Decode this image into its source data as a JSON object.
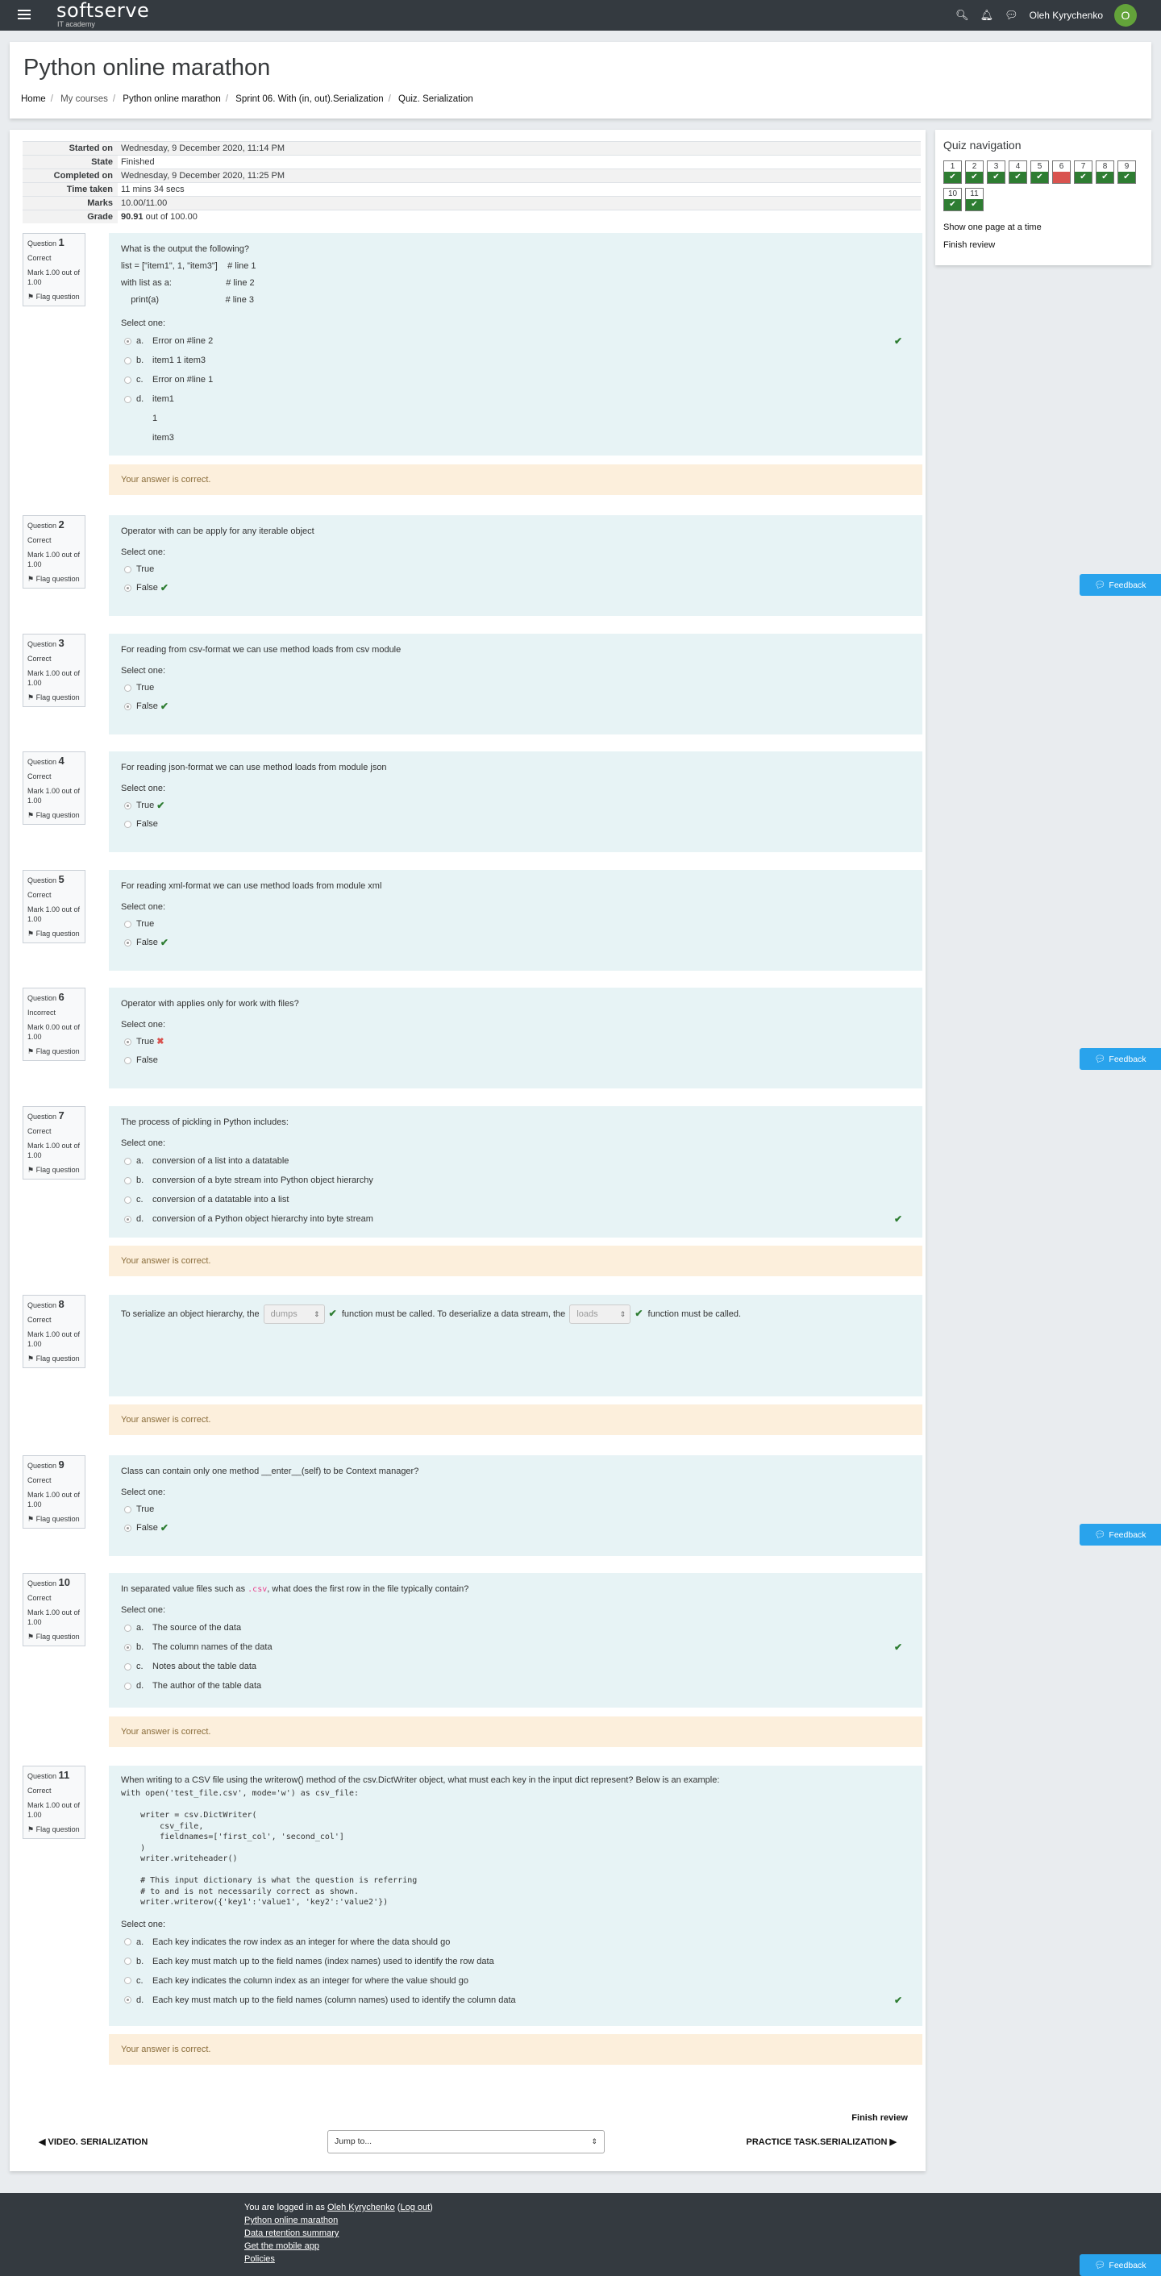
{
  "topbar": {
    "logo_main": "softserve",
    "logo_sub": "IT academy",
    "user_name": "Oleh Kyrychenko",
    "avatar_letter": "O"
  },
  "header": {
    "title": "Python online marathon",
    "breadcrumbs": [
      "Home",
      "My courses",
      "Python online marathon",
      "Sprint 06. With (in, out).Serialization",
      "Quiz. Serialization"
    ]
  },
  "summary": [
    {
      "k": "Started on",
      "v": "Wednesday, 9 December 2020, 11:14 PM"
    },
    {
      "k": "State",
      "v": "Finished"
    },
    {
      "k": "Completed on",
      "v": "Wednesday, 9 December 2020, 11:25 PM"
    },
    {
      "k": "Time taken",
      "v": "11 mins 34 secs"
    },
    {
      "k": "Marks",
      "v": "10.00/11.00"
    },
    {
      "k": "Grade",
      "v_bold": "90.91",
      "v": "out of 100.00"
    }
  ],
  "labels": {
    "question": "Question",
    "flag": "Flag question",
    "select_one": "Select one:",
    "correct_feedback": "Your answer is correct.",
    "true": "True",
    "false": "False"
  },
  "questions": [
    {
      "num": "1",
      "state": "Correct",
      "mark": "Mark 1.00 out of 1.00",
      "text_lines": [
        "What is the output the following?",
        "list = [\"item1\", 1, \"item3\"]    # line 1",
        "with list as a:                      # line 2",
        "    print(a)                           # line 3"
      ],
      "options": [
        {
          "l": "a.",
          "t": "Error on #line 2"
        },
        {
          "l": "b.",
          "t": "item1 1 item3"
        },
        {
          "l": "c.",
          "t": "Error on #line 1"
        },
        {
          "l": "d.",
          "t": "item1"
        }
      ],
      "d_extra": [
        "1",
        "item3"
      ]
    },
    {
      "num": "2",
      "state": "Correct",
      "mark": "Mark 1.00 out of 1.00",
      "text": "Operator with can be apply for any iterable object"
    },
    {
      "num": "3",
      "state": "Correct",
      "mark": "Mark 1.00 out of 1.00",
      "text": "For reading from csv-format we can use  method loads from csv module"
    },
    {
      "num": "4",
      "state": "Correct",
      "mark": "Mark 1.00 out of 1.00",
      "text": "For reading json-format we can use method loads from module json"
    },
    {
      "num": "5",
      "state": "Correct",
      "mark": "Mark 1.00 out of 1.00",
      "text": "For reading xml-format we can use method loads from module xml"
    },
    {
      "num": "6",
      "state": "Incorrect",
      "mark": "Mark 0.00 out of 1.00",
      "text": "Operator with applies only for work with files?"
    },
    {
      "num": "7",
      "state": "Correct",
      "mark": "Mark 1.00 out of 1.00",
      "text": "The process of pickling in Python includes:",
      "options": [
        {
          "l": "a.",
          "t": "conversion of a list into a datatable"
        },
        {
          "l": "b.",
          "t": "conversion of a byte stream into Python object hierarchy"
        },
        {
          "l": "c.",
          "t": "conversion of a datatable into a list"
        },
        {
          "l": "d.",
          "t": "conversion of a Python object hierarchy into byte stream"
        }
      ]
    },
    {
      "num": "8",
      "state": "Correct",
      "mark": "Mark 1.00 out of 1.00",
      "p1": "To serialize an object hierarchy, the",
      "dd1": "dumps",
      "p2": "function must be called. To deserialize a data stream, the",
      "dd2": "loads",
      "p3": "function must be called."
    },
    {
      "num": "9",
      "state": "Correct",
      "mark": "Mark 1.00 out of 1.00",
      "text": "Class can contain only one method __enter__(self) to be Context manager?"
    },
    {
      "num": "10",
      "state": "Correct",
      "mark": "Mark 1.00 out of 1.00",
      "t1": "In separated value files such as",
      "code": ".csv",
      "t2": ", what does the first row in the file typically contain?",
      "options": [
        {
          "l": "a.",
          "t": "The source of the data"
        },
        {
          "l": "b.",
          "t": "The column names of the data"
        },
        {
          "l": "c.",
          "t": "Notes about the table data"
        },
        {
          "l": "d.",
          "t": "The author of the table data"
        }
      ]
    },
    {
      "num": "11",
      "state": "Correct",
      "mark": "Mark 1.00 out of 1.00",
      "text": "When writing to a CSV file using the writerow() method of the csv.DictWriter object, what must each key in the input dict represent? Below is an example:",
      "code": "with open('test_file.csv', mode='w') as csv_file:\n\n    writer = csv.DictWriter(\n        csv_file,\n        fieldnames=['first_col', 'second_col']\n    )\n    writer.writeheader()\n\n    # This input dictionary is what the question is referring\n    # to and is not necessarily correct as shown.\n    writer.writerow({'key1':'value1', 'key2':'value2'})",
      "options": [
        {
          "l": "a.",
          "t": "Each key indicates the row index as an integer for where the data should go"
        },
        {
          "l": "b.",
          "t": "Each key must match up to the field names (index names) used to identify the row data"
        },
        {
          "l": "c.",
          "t": "Each key indicates the column index as an integer for where the value should go"
        },
        {
          "l": "d.",
          "t": "Each key must match up to the field names (column names) used to identify the column data"
        }
      ]
    }
  ],
  "sidebar": {
    "title": "Quiz navigation",
    "buttons": [
      "1",
      "2",
      "3",
      "4",
      "5",
      "6",
      "7",
      "8",
      "9",
      "10",
      "11"
    ],
    "show_one": "Show one page at a time",
    "finish": "Finish review"
  },
  "bottom": {
    "finish": "Finish review",
    "prev": "VIDEO. SERIALIZATION",
    "jump": "Jump to...",
    "next": "PRACTICE TASK.SERIALIZATION"
  },
  "feedback_label": "Feedback",
  "footer": {
    "logged_in": "You are logged in as",
    "user": "Oleh Kyrychenko",
    "logout": "Log out",
    "links": [
      "Python online marathon",
      "Data retention summary",
      "Get the mobile app",
      "Policies"
    ]
  }
}
